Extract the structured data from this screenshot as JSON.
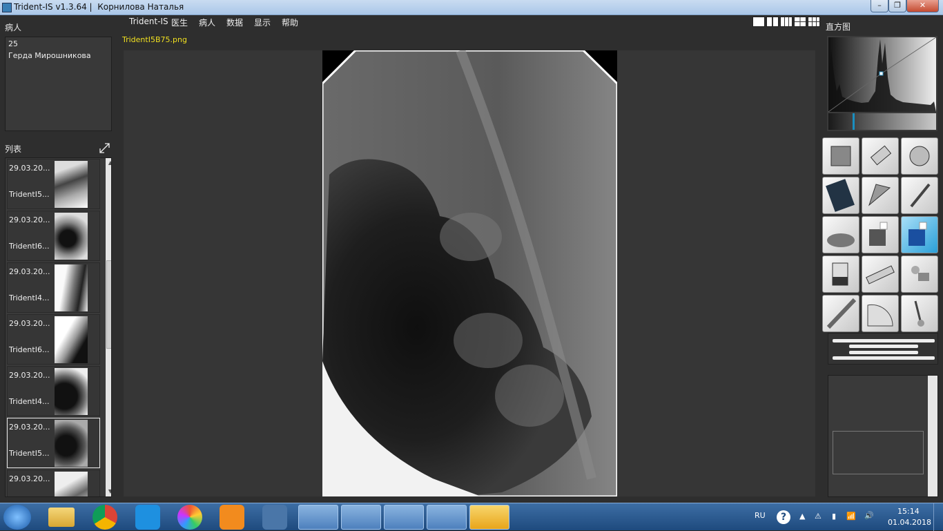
{
  "window": {
    "title": "Trident-IS v1.3.64 |  Корнилова Наталья"
  },
  "left_panel": {
    "patient_header": "病人",
    "patient_id": "25",
    "patient_name": "Герда Мирошникова",
    "list_header": "列表",
    "items": [
      {
        "date": "29.03.20...",
        "file": "TridentI5..."
      },
      {
        "date": "29.03.20...",
        "file": "TridentI6..."
      },
      {
        "date": "29.03.20...",
        "file": "TridentI4..."
      },
      {
        "date": "29.03.20...",
        "file": "TridentI6..."
      },
      {
        "date": "29.03.20...",
        "file": "TridentI4..."
      },
      {
        "date": "29.03.20...",
        "file": "TridentI5..."
      },
      {
        "date": "29.03.20...",
        "file": ""
      }
    ],
    "selected_index": 5
  },
  "menu": [
    "Trident-IS",
    "医生",
    "病人",
    "数据",
    "显示",
    "帮助"
  ],
  "viewer": {
    "file_name": "TridentI5B75.png"
  },
  "right_panel": {
    "histogram_header": "直方图"
  },
  "taskbar": {
    "lang": "RU",
    "time": "15:14",
    "date": "01.04.2018"
  }
}
